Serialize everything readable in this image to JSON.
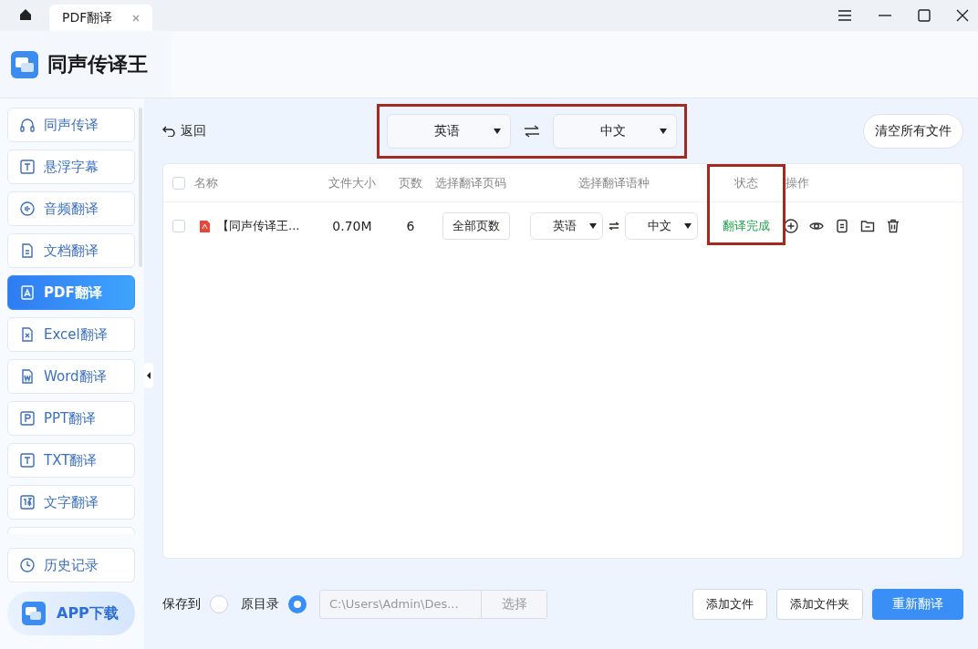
{
  "window": {
    "tabs": [
      {
        "label": "PDF翻译",
        "selected": true
      }
    ]
  },
  "app": {
    "title": "同声传译王"
  },
  "sidebar": {
    "items": [
      {
        "label": "同声传译",
        "selected": false
      },
      {
        "label": "悬浮字幕",
        "selected": false
      },
      {
        "label": "音频翻译",
        "selected": false
      },
      {
        "label": "文档翻译",
        "selected": false
      },
      {
        "label": "PDF翻译",
        "selected": true
      },
      {
        "label": "Excel翻译",
        "selected": false
      },
      {
        "label": "Word翻译",
        "selected": false
      },
      {
        "label": "PPT翻译",
        "selected": false
      },
      {
        "label": "TXT翻译",
        "selected": false
      },
      {
        "label": "文字翻译",
        "selected": false
      }
    ],
    "history": "历史记录",
    "app_download": "APP下载"
  },
  "toolbar": {
    "back": "返回",
    "source_language": "英语",
    "target_language": "中文",
    "highlighted": true,
    "clear": "清空所有文件"
  },
  "table": {
    "select_all_checked": false,
    "columns": [
      "名称",
      "文件大小",
      "页数",
      "选择翻译页码",
      "选择翻译语种",
      "状态",
      "操作"
    ],
    "status_highlighted": true,
    "rows": [
      {
        "checked": false,
        "name": "【同声传译王...",
        "size": "0.70M",
        "pages": "6",
        "page_range": "全部页数",
        "source": "英语",
        "target": "中文",
        "status": "翻译完成"
      }
    ]
  },
  "footer": {
    "save_to": "保存到",
    "options": [
      {
        "label": "原目录",
        "selected": true
      }
    ],
    "custom_selected": false,
    "path": "C:\\Users\\Admin\\Des...",
    "choose": "选择",
    "add_file": "添加文件",
    "add_folder": "添加文件夹",
    "retranslate": "重新翻译"
  }
}
